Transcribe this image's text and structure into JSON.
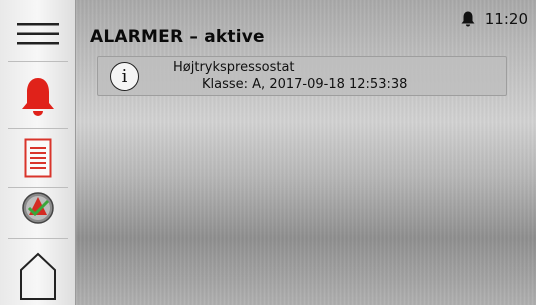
{
  "header": {
    "title": "ALARMER – aktive",
    "time": "11:20"
  },
  "sidebar": {
    "items": [
      {
        "icon": "menu-icon"
      },
      {
        "icon": "bell-icon"
      },
      {
        "icon": "log-icon"
      },
      {
        "icon": "acknowledge-icon"
      },
      {
        "icon": "home-icon"
      }
    ]
  },
  "alarms": [
    {
      "icon": "info-icon",
      "info_glyph": "i",
      "name": "Højtrykspressostat",
      "detail": "Klasse: A, 2017-09-18 12:53:38"
    }
  ],
  "colors": {
    "alarm_red": "#e0221a",
    "log_red": "#d9342b",
    "ack_green": "#3aa63a"
  }
}
